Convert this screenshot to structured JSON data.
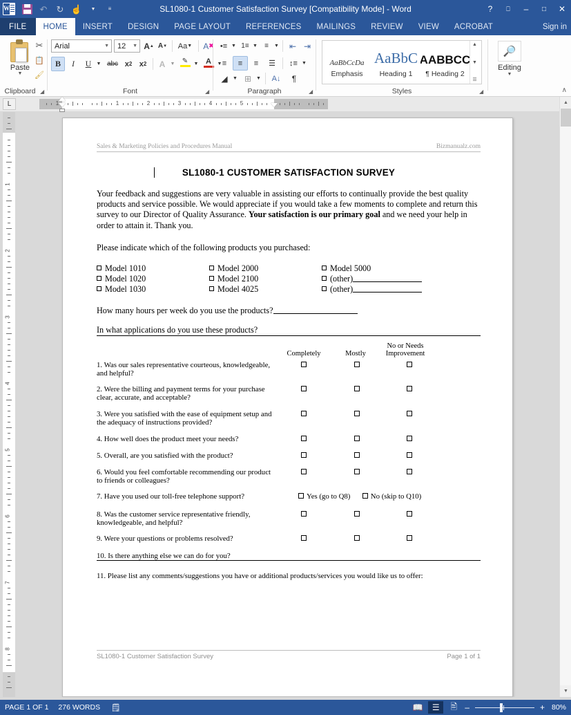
{
  "window": {
    "title": "SL1080-1 Customer Satisfaction Survey [Compatibility Mode] - Word",
    "sign_in": "Sign in",
    "help_icon": "?",
    "ribbon_display_icon": "⬛",
    "minimize_icon": "–",
    "restore_icon": "❐",
    "close_icon": "✕",
    "accent_color": "#2b579a"
  },
  "quick_access": {
    "app_icon": "word-logo",
    "items": [
      {
        "name": "save-icon",
        "glyph": ""
      },
      {
        "name": "undo-icon",
        "glyph": "↶"
      },
      {
        "name": "redo-icon",
        "glyph": "↻"
      },
      {
        "name": "touch-mode-icon",
        "glyph": "☝"
      },
      {
        "name": "customize-qat-icon",
        "glyph": "≡"
      }
    ]
  },
  "tabs": [
    {
      "label": "FILE",
      "active": false,
      "file": true
    },
    {
      "label": "HOME",
      "active": true
    },
    {
      "label": "INSERT",
      "active": false
    },
    {
      "label": "DESIGN",
      "active": false
    },
    {
      "label": "PAGE LAYOUT",
      "active": false
    },
    {
      "label": "REFERENCES",
      "active": false
    },
    {
      "label": "MAILINGS",
      "active": false
    },
    {
      "label": "REVIEW",
      "active": false
    },
    {
      "label": "VIEW",
      "active": false
    },
    {
      "label": "ACROBAT",
      "active": false
    }
  ],
  "ribbon": {
    "clipboard": {
      "label": "Clipboard",
      "paste_label": "Paste",
      "cut_icon": "✂",
      "copy_icon": "❐",
      "format_painter_icon": "🖌"
    },
    "font": {
      "label": "Font",
      "font_name": "Arial",
      "font_size": "12",
      "grow_font": "A",
      "shrink_font": "A",
      "change_case": "Aa",
      "clear_formatting": "A",
      "bold": "B",
      "italic": "I",
      "underline": "U",
      "strikethrough": "abc",
      "subscript": "x₂",
      "superscript": "x²",
      "text_effects": "A",
      "highlight": "ab",
      "font_color": "A"
    },
    "paragraph": {
      "label": "Paragraph",
      "bullets_icon": "•≡",
      "numbering_icon": "1≡",
      "multilevel_icon": "≡",
      "decrease_indent_icon": "⇤",
      "increase_indent_icon": "⇥",
      "align_left_icon": "≡",
      "align_center_icon": "≡",
      "align_right_icon": "≡",
      "justify_icon": "≡",
      "line_spacing_icon": "↕",
      "shading_icon": "◢",
      "borders_icon": "⊞",
      "sort_icon": "A↓",
      "show_marks_icon": "¶"
    },
    "styles": {
      "label": "Styles",
      "items": [
        {
          "preview": "AaBbCcDa",
          "name": "Emphasis"
        },
        {
          "preview": "AaBbC",
          "name": "Heading 1"
        },
        {
          "preview": "AABBCC",
          "name": "¶ Heading 2"
        }
      ]
    },
    "editing": {
      "label": "Editing",
      "button_label": "Editing",
      "icon": "🔍"
    },
    "collapse_icon": "∧"
  },
  "ruler": {
    "tab_selector": "L",
    "h_numbers": [
      "1",
      "1",
      "2",
      "3",
      "4",
      "5"
    ],
    "v_numbers": [
      "1",
      "2",
      "3",
      "4",
      "5",
      "6",
      "7",
      "8"
    ]
  },
  "document": {
    "header_left": "Sales & Marketing Policies and Procedures Manual",
    "header_right": "Bizmanualz.com",
    "title": "SL1080-1 CUSTOMER SATISFACTION SURVEY",
    "intro_part1": "Your feedback and suggestions are very valuable in assisting our efforts to continually provide the best quality products and service possible.  We would appreciate if you would take a few moments to complete and return this survey to our Director of Quality Assurance.  ",
    "intro_bold": "Your satisfaction is our primary goal",
    "intro_part2": " and we need your help in order to attain it.  Thank you.",
    "products_prompt": "Please indicate which of the following products you purchased:",
    "products": {
      "col1": [
        "Model 1010",
        "Model 1020",
        "Model 1030"
      ],
      "col2": [
        "Model 2000",
        "Model 2100",
        "Model 4025"
      ],
      "col3": [
        "Model 5000",
        "(other)",
        "(other)"
      ]
    },
    "hours_question": "How many hours per week do you use the products?",
    "applications_question": "In what applications do you use these products?",
    "scale_headers": {
      "completely": "Completely",
      "mostly": "Mostly",
      "improvement_line1": "No or Needs",
      "improvement_line2": "Improvement"
    },
    "questions": [
      {
        "num": "1.",
        "text": "1. Was our sales representative courteous, knowledgeable, and helpful?",
        "type": "scale"
      },
      {
        "num": "2.",
        "text": "2. Were the billing and payment terms for your purchase clear, accurate, and acceptable?",
        "type": "scale"
      },
      {
        "num": "3.",
        "text": "3. Were you satisfied with the ease of equipment setup and the adequacy of instructions provided?",
        "type": "scale"
      },
      {
        "num": "4.",
        "text": "4. How well does the product meet your needs?",
        "type": "scale"
      },
      {
        "num": "5.",
        "text": "5. Overall, are you satisfied with the product?",
        "type": "scale"
      },
      {
        "num": "6.",
        "text": "6. Would you feel comfortable recommending our product to friends or colleagues?",
        "type": "scale"
      },
      {
        "num": "7.",
        "text": "7. Have you used our toll-free telephone support?",
        "type": "yesno",
        "yes_label": "Yes (go to Q8)",
        "no_label": "No (skip to Q10)"
      },
      {
        "num": "8.",
        "text": "8. Was the customer service representative friendly, knowledgeable, and helpful?",
        "type": "scale"
      },
      {
        "num": "9.",
        "text": "9. Were your questions or problems resolved?",
        "type": "scale"
      }
    ],
    "question10": "10. Is there anything else we can do for you?",
    "question11": "11. Please list any comments/suggestions you have or additional products/services you would like us to offer:",
    "footer_left": "SL1080-1 Customer Satisfaction Survey",
    "footer_right": "Page 1 of 1"
  },
  "status_bar": {
    "page_info": "PAGE 1 OF 1",
    "word_count": "276 WORDS",
    "proofing_icon": "⌨",
    "read_mode_icon": "📖",
    "print_layout_icon": "☰",
    "web_layout_icon": "☷",
    "zoom_out": "–",
    "zoom_in": "+",
    "zoom_level": "80%"
  }
}
